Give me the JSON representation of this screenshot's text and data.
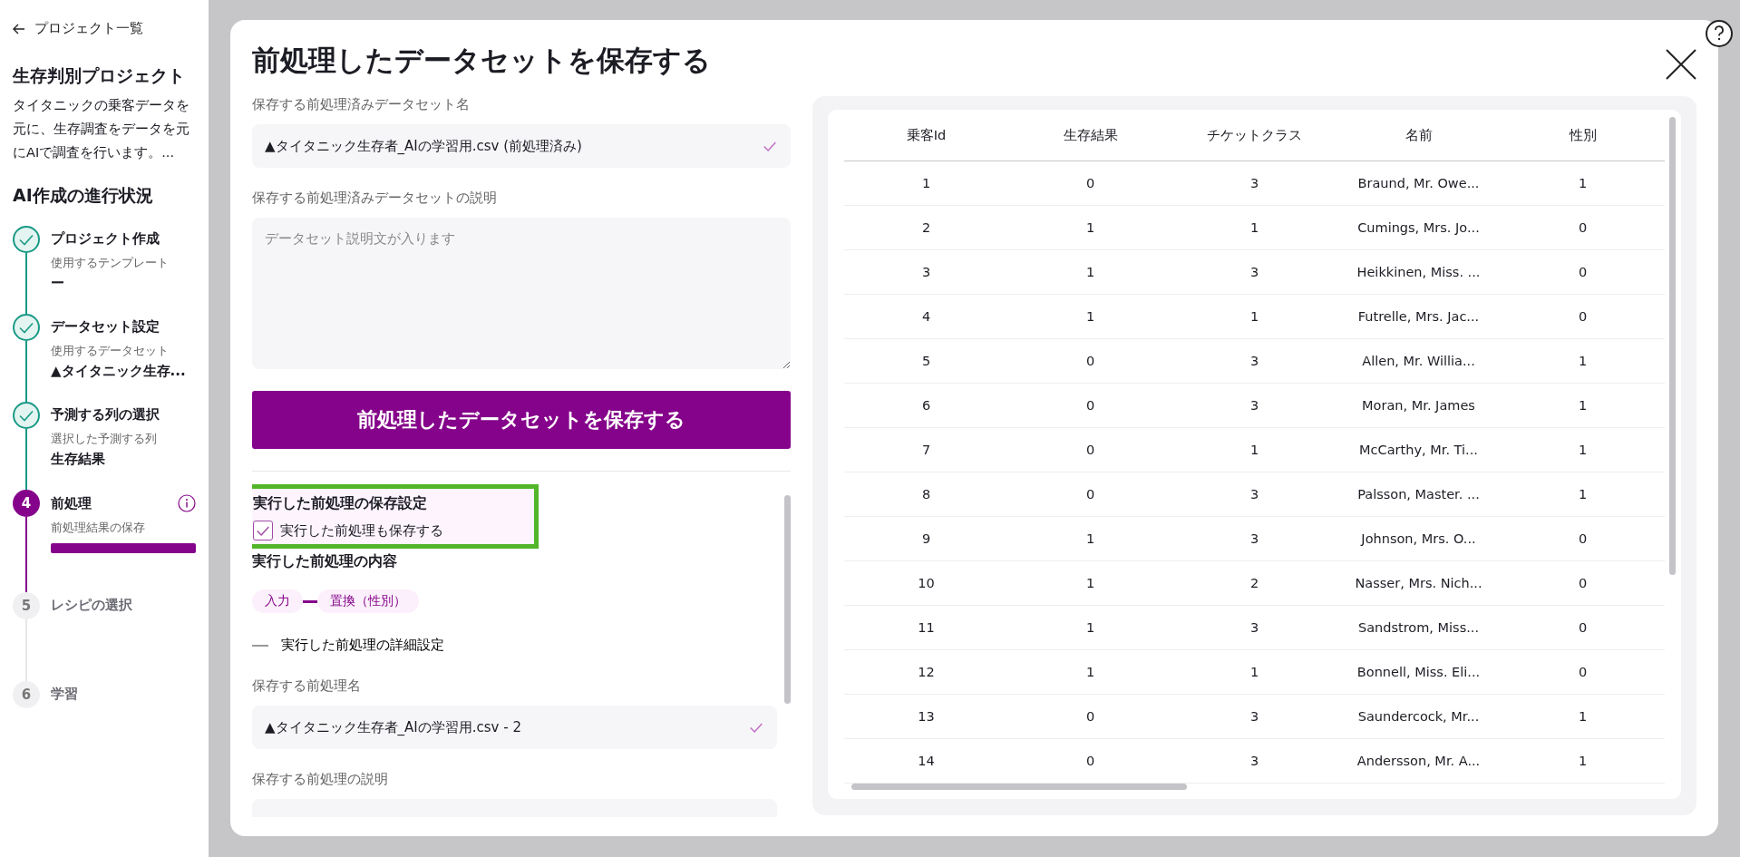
{
  "sidebar": {
    "back_link": "プロジェクト一覧",
    "project_title": "生存判別プロジェクト",
    "project_description": "タイタニックの乗客データを元に、生存調査をデータを元にAIで調査を行います。...",
    "progress_title": "AI作成の進行状況",
    "steps": [
      {
        "completed": true,
        "active": false,
        "title": "プロジェクト作成",
        "sublabel": "使用するテンプレート",
        "value": "ー"
      },
      {
        "completed": true,
        "active": false,
        "title": "データセット設定",
        "sublabel": "使用するデータセット",
        "value": "▲タイタニック生存..."
      },
      {
        "completed": true,
        "active": false,
        "title": "予測する列の選択",
        "sublabel": "選択した予測する列",
        "value": "生存結果"
      },
      {
        "completed": false,
        "active": true,
        "number": "4",
        "title": "前処理",
        "sublabel": "前処理結果の保存",
        "level": 1,
        "info": true
      },
      {
        "completed": false,
        "active": false,
        "number": "5",
        "title": "レシピの選択"
      },
      {
        "completed": false,
        "active": false,
        "number": "6",
        "title": "学習"
      }
    ]
  },
  "modal": {
    "title": "前処理したデータセットを保存する",
    "dataset_name": {
      "label": "保存する前処理済みデータセット名",
      "value": "▲タイタニック生存者_AIの学習用.csv (前処理済み)",
      "valid": true
    },
    "dataset_description": {
      "label": "保存する前処理済みデータセットの説明",
      "placeholder": "データセット説明文が入ります"
    },
    "save_button": "前処理したデータセットを保存する",
    "preprocess_settings": {
      "highlighted": true,
      "title": "実行した前処理の保存設定",
      "checkbox": {
        "label": "実行した前処理も保存する",
        "checked": true
      }
    },
    "preprocess_content": {
      "title": "実行した前処理の内容",
      "pipeline": [
        "入力",
        "置換（性別）"
      ]
    },
    "details": {
      "label": "実行した前処理の詳細設定",
      "expanded": true
    },
    "preprocess_name": {
      "label": "保存する前処理名",
      "value": "▲タイタニック生存者_AIの学習用.csv - 2",
      "valid": true
    },
    "preprocess_description": {
      "label": "保存する前処理の説明"
    },
    "table": {
      "columns": [
        "乗客Id",
        "生存結果",
        "チケットクラス",
        "名前",
        "性別"
      ],
      "rows": [
        [
          "1",
          "0",
          "3",
          "Braund, Mr. Owe...",
          "1"
        ],
        [
          "2",
          "1",
          "1",
          "Cumings, Mrs. Jo...",
          "0"
        ],
        [
          "3",
          "1",
          "3",
          "Heikkinen, Miss. ...",
          "0"
        ],
        [
          "4",
          "1",
          "1",
          "Futrelle, Mrs. Jac...",
          "0"
        ],
        [
          "5",
          "0",
          "3",
          "Allen, Mr. Willia...",
          "1"
        ],
        [
          "6",
          "0",
          "3",
          "Moran, Mr. James",
          "1"
        ],
        [
          "7",
          "0",
          "1",
          "McCarthy, Mr. Ti...",
          "1"
        ],
        [
          "8",
          "0",
          "3",
          "Palsson, Master. ...",
          "1"
        ],
        [
          "9",
          "1",
          "3",
          "Johnson, Mrs. O...",
          "0"
        ],
        [
          "10",
          "1",
          "2",
          "Nasser, Mrs. Nich...",
          "0"
        ],
        [
          "11",
          "1",
          "3",
          "Sandstrom, Miss...",
          "0"
        ],
        [
          "12",
          "1",
          "1",
          "Bonnell, Miss. Eli...",
          "0"
        ],
        [
          "13",
          "0",
          "3",
          "Saundercock, Mr...",
          "1"
        ],
        [
          "14",
          "0",
          "3",
          "Andersson, Mr. A...",
          "1"
        ]
      ]
    }
  }
}
